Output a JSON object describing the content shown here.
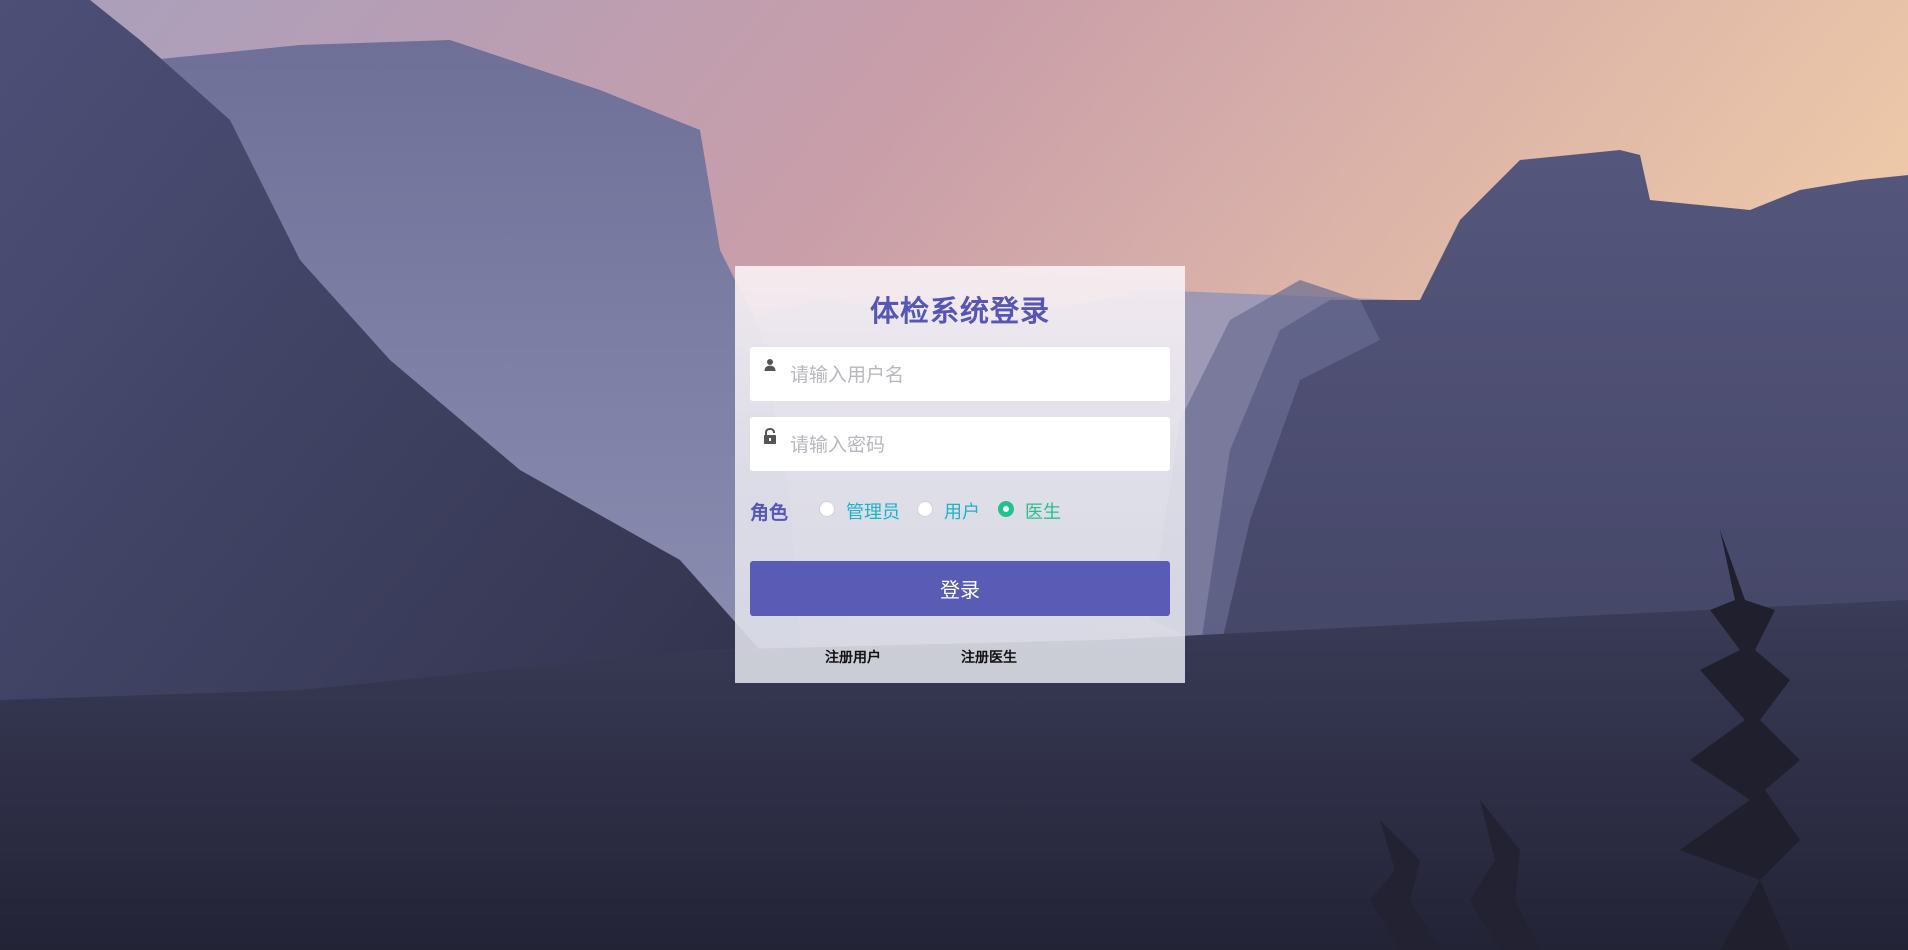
{
  "background": {
    "description_icon": "mountain-valley-photo"
  },
  "login": {
    "title": "体检系统登录",
    "username": {
      "placeholder": "请输入用户名",
      "value": "",
      "icon": "user-icon"
    },
    "password": {
      "placeholder": "请输入密码",
      "value": "",
      "icon": "lock-icon"
    },
    "role": {
      "label": "角色",
      "options": [
        {
          "label": "管理员",
          "checked": false
        },
        {
          "label": "用户",
          "checked": false
        },
        {
          "label": "医生",
          "checked": true
        }
      ]
    },
    "submit_label": "登录",
    "register_user_label": "注册用户",
    "register_doctor_label": "注册医生"
  },
  "colors": {
    "primary": "#5a5bb5",
    "accent_teal": "#1ab3c9",
    "checked_green": "#22c28e"
  }
}
